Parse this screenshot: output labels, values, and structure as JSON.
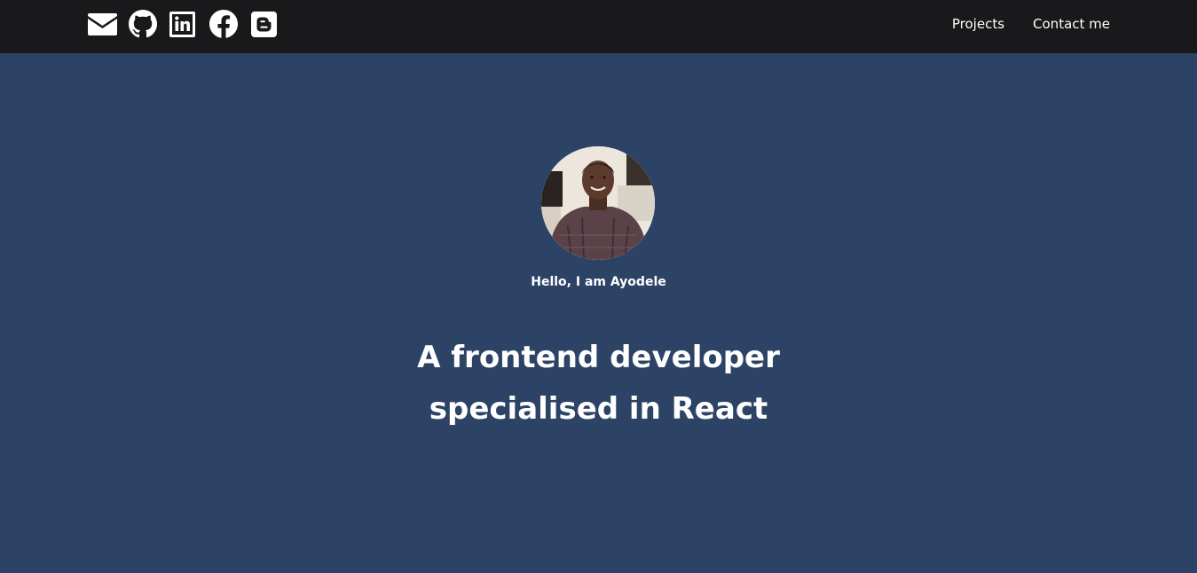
{
  "header": {
    "social_icons": [
      {
        "icon": "mail-icon"
      },
      {
        "icon": "github-icon"
      },
      {
        "icon": "linkedin-icon"
      },
      {
        "icon": "facebook-icon"
      },
      {
        "icon": "blogger-icon"
      }
    ],
    "nav": {
      "projects": "Projects",
      "contact": "Contact me"
    }
  },
  "hero": {
    "avatar_icon": "profile-photo",
    "greeting": "Hello, I am Ayodele",
    "headline_line1": "A frontend developer",
    "headline_line2": "specialised in React"
  },
  "colors": {
    "header_bg": "#19191b",
    "hero_bg": "#2c4365",
    "text": "#ffffff"
  }
}
